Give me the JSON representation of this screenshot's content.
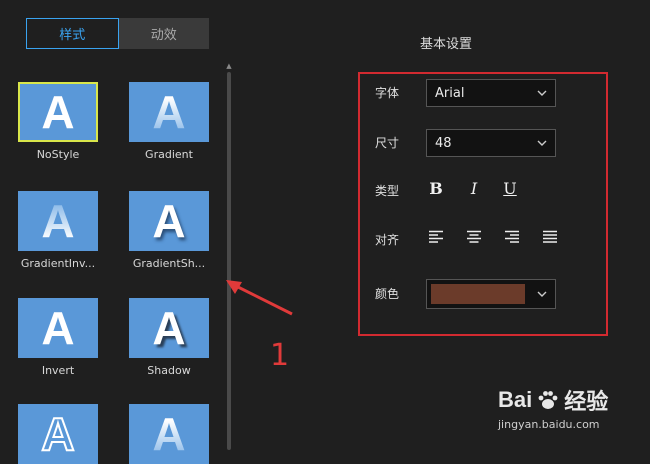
{
  "tabs": [
    {
      "label": "样式",
      "active": true
    },
    {
      "label": "动效",
      "active": false
    }
  ],
  "styles": [
    {
      "label": "NoStyle",
      "letter": "A",
      "selected": true
    },
    {
      "label": "Gradient",
      "letter": "A"
    },
    {
      "label": "GradientInv...",
      "letter": "A"
    },
    {
      "label": "GradientSh...",
      "letter": "A"
    },
    {
      "label": "Invert",
      "letter": "A"
    },
    {
      "label": "Shadow",
      "letter": "A"
    },
    {
      "label": "",
      "letter": "A"
    },
    {
      "label": "",
      "letter": "A"
    }
  ],
  "settings": {
    "title": "基本设置",
    "font": {
      "label": "字体",
      "value": "Arial"
    },
    "size": {
      "label": "尺寸",
      "value": "48"
    },
    "type": {
      "label": "类型",
      "bold": "B",
      "italic": "I",
      "underline": "U"
    },
    "align": {
      "label": "对齐"
    },
    "color": {
      "label": "颜色",
      "value": "#6b3b2a"
    }
  },
  "annotation": {
    "number": "1",
    "color": "#e03a3a"
  },
  "watermark": {
    "brand": "Bai",
    "brand_suffix": "经验",
    "url": "jingyan.baidu.com"
  }
}
